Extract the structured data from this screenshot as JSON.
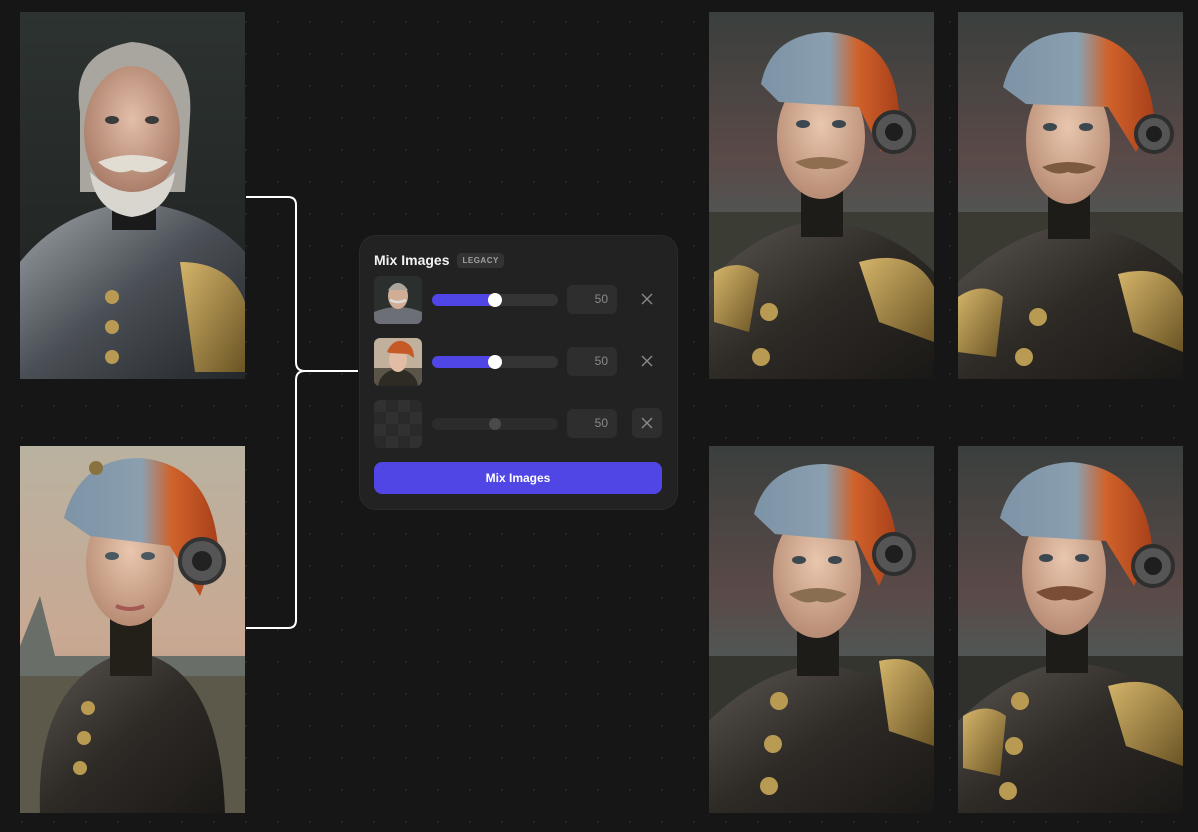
{
  "panel": {
    "title": "Mix Images",
    "badge": "LEGACY",
    "rows": [
      {
        "thumbnail": "elderly-man-armor-portrait",
        "weight": "50",
        "level": 0.5
      },
      {
        "thumbnail": "woman-helmet-portrait",
        "weight": "50",
        "level": 0.5
      },
      {
        "thumbnail": "empty-image-slot",
        "weight": "50",
        "level": 0.5
      }
    ],
    "submit_label": "Mix Images"
  },
  "colors": {
    "background": "#161616",
    "panel": "#222222",
    "accent": "#4f46e5",
    "connector": "#ffffff"
  },
  "icons": {
    "remove": "close-icon"
  },
  "images": [
    {
      "role": "source",
      "subject": "elderly-man-armor-portrait"
    },
    {
      "role": "source",
      "subject": "woman-helmet-portrait"
    },
    {
      "role": "output",
      "subject": "man-helmet-armor-portrait"
    },
    {
      "role": "output",
      "subject": "man-helmet-armor-portrait"
    },
    {
      "role": "output",
      "subject": "man-helmet-armor-portrait"
    },
    {
      "role": "output",
      "subject": "man-helmet-armor-portrait"
    }
  ]
}
